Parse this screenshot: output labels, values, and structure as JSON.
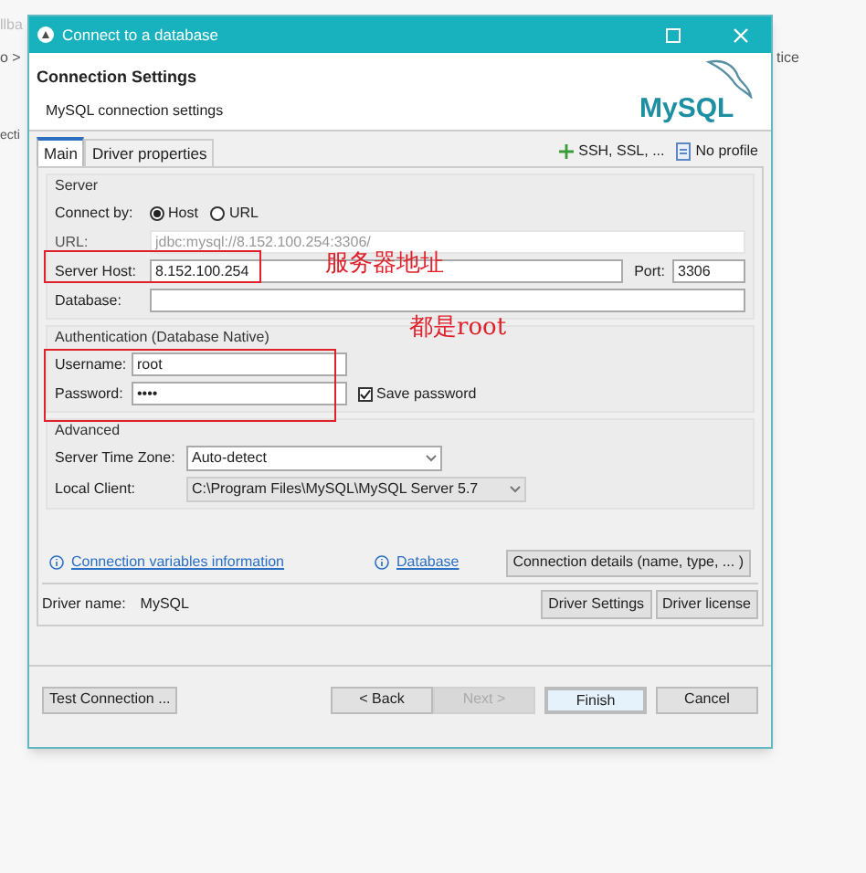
{
  "background_fragments": [
    {
      "kind": "top",
      "text": "llba"
    },
    {
      "kind": "left",
      "text": "o >"
    },
    {
      "kind": "left2",
      "text": "ecti"
    },
    {
      "kind": "right",
      "text": "tice"
    }
  ],
  "window": {
    "title": "Connect to a database"
  },
  "header": {
    "title": "Connection Settings",
    "subtitle": "MySQL connection settings",
    "logo": "MySQL"
  },
  "tabs": [
    {
      "label": "Main",
      "selected": true
    },
    {
      "label": "Driver properties",
      "selected": false
    }
  ],
  "tab_actions": [
    {
      "kind": "add",
      "label": "SSH, SSL, ..."
    },
    {
      "kind": "profile",
      "label": "No profile"
    }
  ],
  "server": {
    "title": "Server",
    "connect_by_label": "Connect by:",
    "connect_by": [
      {
        "label": "Host",
        "selected": true
      },
      {
        "label": "URL",
        "selected": false
      }
    ],
    "url_label": "URL:",
    "url": "jdbc:mysql://8.152.100.254:3306/",
    "host_label": "Server Host:",
    "host": "8.152.100.254",
    "port_label": "Port:",
    "port": "3306",
    "database_label": "Database:"
  },
  "authentication": {
    "title": "Authentication (Database Native)",
    "username_label": "Username:",
    "username": "root",
    "password_label": "Password:",
    "password": "••••",
    "save_password": {
      "label": "Save password",
      "checked": true
    }
  },
  "advanced": {
    "title": "Advanced",
    "timezone_label": "Server Time Zone:",
    "timezone": "Auto-detect",
    "client_label": "Local Client:",
    "client": "C:\\Program Files\\MySQL\\MySQL Server 5.7"
  },
  "links": [
    "Connection variables information",
    "Database"
  ],
  "details_button": "Connection details (name, type, ... )",
  "driver": {
    "label": "Driver name:",
    "name": "MySQL",
    "buttons": [
      "Driver Settings",
      "Driver license"
    ]
  },
  "footer": {
    "test_button": "Test Connection ...",
    "buttons": [
      {
        "label": "< Back",
        "disabled": false,
        "default": false
      },
      {
        "label": "Next >",
        "disabled": true,
        "default": false
      },
      {
        "label": "Finish",
        "disabled": false,
        "default": true
      },
      {
        "label": "Cancel",
        "disabled": false,
        "default": false
      }
    ]
  },
  "annotations": [
    {
      "kind": "host",
      "note": "服务器地址"
    },
    {
      "kind": "credentials",
      "note": "都是root"
    }
  ]
}
